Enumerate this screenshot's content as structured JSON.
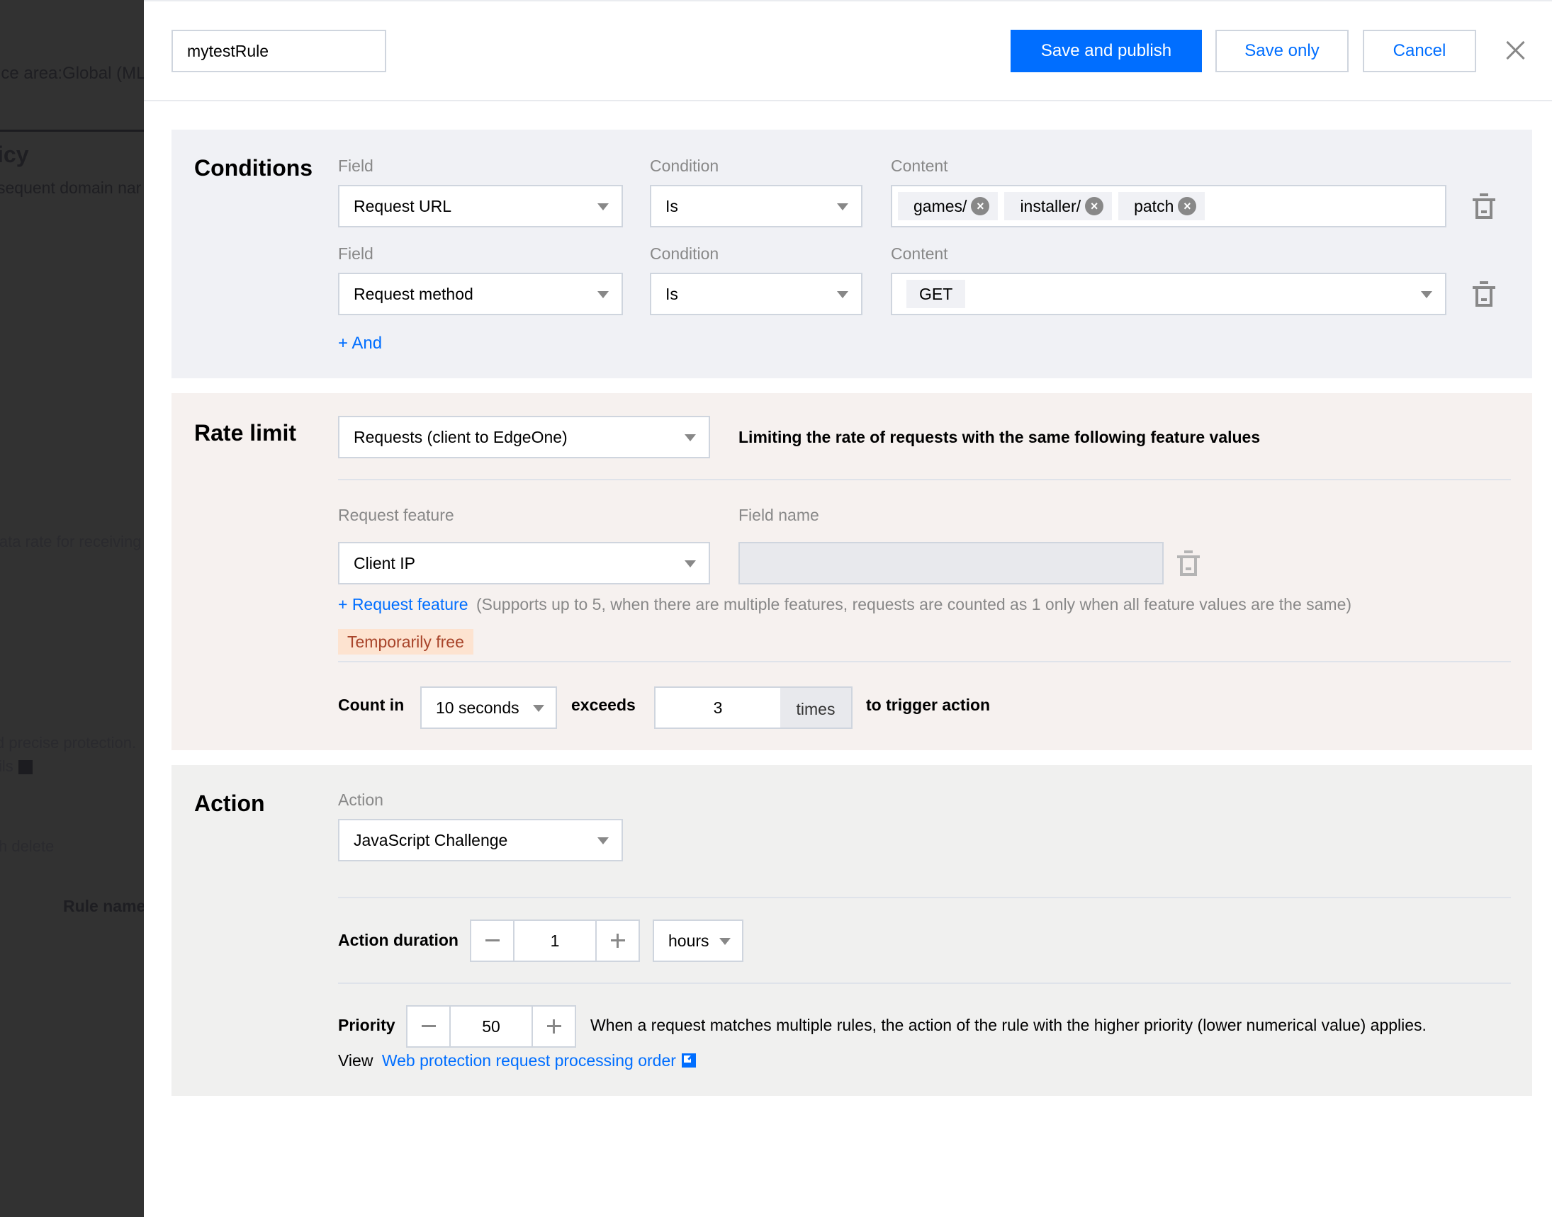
{
  "background": {
    "texts": [
      "ice area:Global (ML",
      "icy",
      "sequent domain nar",
      "lata rate for receiving",
      "d precise protection.",
      "ils",
      "h delete",
      "Rule name"
    ]
  },
  "header": {
    "rule_name_value": "mytestRule",
    "save_publish_label": "Save and publish",
    "save_only_label": "Save only",
    "cancel_label": "Cancel"
  },
  "conditions": {
    "title": "Conditions",
    "rows": [
      {
        "field_label": "Field",
        "field_value": "Request URL",
        "condition_label": "Condition",
        "condition_value": "Is",
        "content_label": "Content",
        "content_tags": [
          "games/",
          "installer/",
          "patch"
        ]
      },
      {
        "field_label": "Field",
        "field_value": "Request method",
        "condition_label": "Condition",
        "condition_value": "Is",
        "content_label": "Content",
        "content_value": "GET"
      }
    ],
    "add_label": "+ And"
  },
  "rate_limit": {
    "title": "Rate limit",
    "type_value": "Requests (client to EdgeOne)",
    "description": "Limiting the rate of requests with the same following feature values",
    "feature_label": "Request feature",
    "field_name_label": "Field name",
    "feature_value": "Client IP",
    "field_name_value": "",
    "add_feature_label": "+ Request feature",
    "add_feature_hint": "(Supports up to 5, when there are multiple features, requests are counted as 1 only when all feature values are the same)",
    "badge": "Temporarily free",
    "count_in_label": "Count in",
    "period_value": "10 seconds",
    "exceeds_label": "exceeds",
    "threshold_value": "3",
    "times_label": "times",
    "trigger_label": "to trigger action"
  },
  "action": {
    "title": "Action",
    "action_label": "Action",
    "action_value": "JavaScript Challenge",
    "duration_label": "Action duration",
    "duration_value": "1",
    "duration_unit": "hours",
    "priority_label": "Priority",
    "priority_value": "50",
    "priority_hint": "When a request matches multiple rules, the action of the rule with the higher priority (lower numerical value) applies.",
    "view_label": "View",
    "view_link": "Web protection request processing order"
  },
  "colors": {
    "primary": "#006eff",
    "badge_bg": "#fde3d0",
    "badge_text": "#a8442a"
  }
}
